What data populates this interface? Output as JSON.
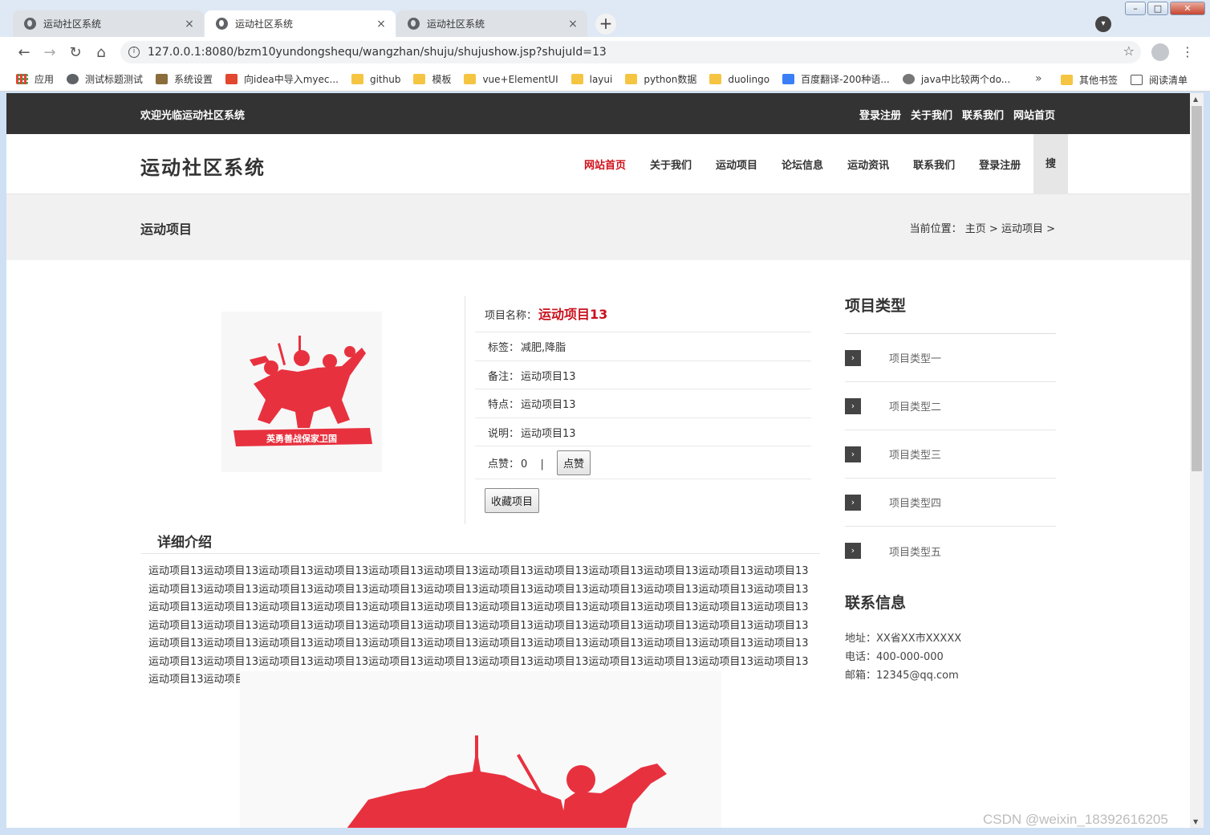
{
  "browser": {
    "tabs": [
      {
        "title": "运动社区系统",
        "close": "×"
      },
      {
        "title": "运动社区系统",
        "close": "×"
      },
      {
        "title": "运动社区系统",
        "close": "×"
      }
    ],
    "new_tab": "+",
    "url": "127.0.0.1:8080/bzm10yundongshequ/wangzhan/shuju/shujushow.jsp?shujuId=13",
    "bookmarks": [
      {
        "label": "应用",
        "icon": "apps-grid-icon"
      },
      {
        "label": "测试标题测试",
        "icon": "globe-icon"
      },
      {
        "label": "系统设置",
        "icon": "image-icon"
      },
      {
        "label": "向idea中导入myec...",
        "icon": "csdn-icon"
      },
      {
        "label": "github",
        "icon": "folder-icon"
      },
      {
        "label": "模板",
        "icon": "folder-icon"
      },
      {
        "label": "vue+ElementUI",
        "icon": "folder-icon"
      },
      {
        "label": "layui",
        "icon": "folder-icon"
      },
      {
        "label": "python数据",
        "icon": "folder-icon"
      },
      {
        "label": "duolingo",
        "icon": "folder-icon"
      },
      {
        "label": "百度翻译-200种语...",
        "icon": "translate-icon"
      },
      {
        "label": "java中比较两个do...",
        "icon": "java-icon"
      }
    ],
    "bookmarks_more": "»",
    "other_bookmarks": "其他书签",
    "reading_list": "阅读清单"
  },
  "topbar": {
    "welcome": "欢迎光临运动社区系统",
    "links": [
      "登录注册",
      "关于我们",
      "联系我们",
      "网站首页"
    ]
  },
  "header": {
    "logo": "运动社区系统",
    "nav": [
      "网站首页",
      "关于我们",
      "运动项目",
      "论坛信息",
      "运动资讯",
      "联系我们",
      "登录注册"
    ],
    "search": "搜"
  },
  "crumbband": {
    "title": "运动项目",
    "breadcrumb": "当前位置： 主页 > 运动项目 >"
  },
  "product": {
    "name_label": "项目名称：",
    "name": "运动项目13",
    "tags_label": "标签：",
    "tags": "减肥,降脂",
    "remark_label": "备注：",
    "remark": "运动项目13",
    "feature_label": "特点：",
    "feature": "运动项目13",
    "desc_label": "说明：",
    "desc": "运动项目13",
    "likes_label": "点赞：",
    "likes": "0",
    "sep": "|",
    "like_button": "点赞",
    "collect_button": "收藏项目",
    "image_caption": "英勇善战保家卫国"
  },
  "detail": {
    "title": "详细介绍",
    "text": "运动项目13运动项目13运动项目13运动项目13运动项目13运动项目13运动项目13运动项目13运动项目13运动项目13运动项目13运动项目13运动项目13运动项目13运动项目13运动项目13运动项目13运动项目13运动项目13运动项目13运动项目13运动项目13运动项目13运动项目13运动项目13运动项目13运动项目13运动项目13运动项目13运动项目13运动项目13运动项目13运动项目13运动项目13运动项目13运动项目13运动项目13运动项目13运动项目13运动项目13运动项目13运动项目13运动项目13运动项目13运动项目13运动项目13运动项目13运动项目13运动项目13运动项目13运动项目13运动项目13运动项目13运动项目13运动项目13运动项目13运动项目13运动项目13运动项目13运动项目13运动项目13运动项目13运动项目13运动项目13运动项目13运动项目13运动项目13运动项目13运动项目13运动项目13运动项目13运动项目13运动项目13运动项目13运动项目13运动项目13运动项目13运动项目13"
  },
  "sidebar": {
    "title": "项目类型",
    "categories": [
      "项目类型一",
      "项目类型二",
      "项目类型三",
      "项目类型四",
      "项目类型五"
    ],
    "contact_title": "联系信息",
    "address": "地址：XX省XX市XXXXX",
    "phone": "电话：400-000-000",
    "email": "邮箱：12345@qq.com"
  },
  "watermark": "CSDN @weixin_18392616205",
  "colors": {
    "accent": "#d0111b",
    "topbar": "#333333"
  }
}
